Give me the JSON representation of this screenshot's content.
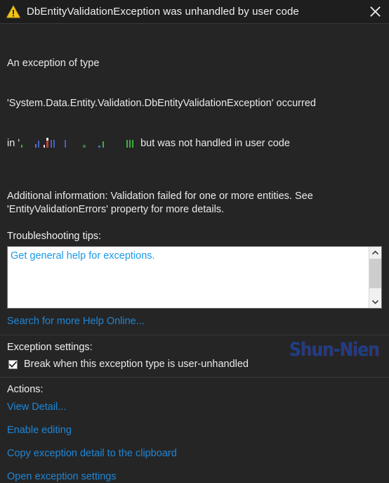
{
  "dialog": {
    "title": "DbEntityValidationException was unhandled by user code",
    "warning_icon": "warning-triangle-icon",
    "close_icon": "close-icon"
  },
  "description": {
    "line1": "An exception of type",
    "line2": "'System.Data.Entity.Validation.DbEntityValidationException' occurred",
    "line3_prefix": "in '",
    "line3_suffix": " but was not handled in user code",
    "redacted_note": "obscured-assembly-name"
  },
  "additional_information": "Additional information: Validation failed for one or more entities. See 'EntityValidationErrors' property for more details.",
  "troubleshooting": {
    "label": "Troubleshooting tips:",
    "tips": [
      "Get general help for exceptions."
    ],
    "scrollbar": {
      "up_icon": "chevron-up-icon",
      "down_icon": "chevron-down-icon"
    }
  },
  "search_help_link": "Search for more Help Online...",
  "exception_settings": {
    "label": "Exception settings:",
    "checkbox": {
      "label": "Break when this exception type is user-unhandled",
      "checked": true,
      "check_icon": "check-icon"
    }
  },
  "actions": {
    "label": "Actions:",
    "items": [
      "View Detail...",
      "Enable editing",
      "Copy exception detail to the clipboard",
      "Open exception settings"
    ]
  },
  "watermark": "Shun-Nien",
  "colors": {
    "background": "#252526",
    "titlebar": "#1e1e1e",
    "link": "#1f86d4",
    "tip_link": "#1a9ae8",
    "warning": "#f5c518",
    "text": "#eaeaea",
    "watermark": "#1c3f86"
  }
}
